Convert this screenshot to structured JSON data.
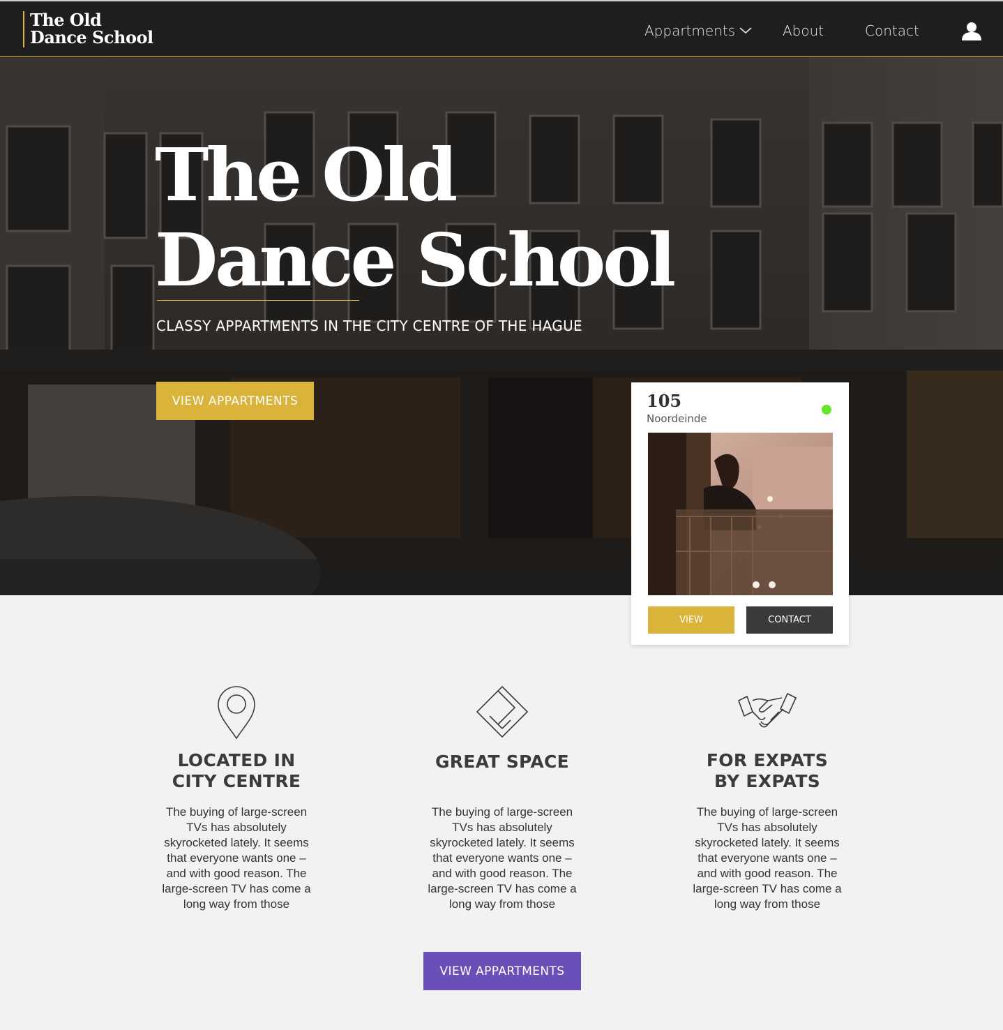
{
  "brand": {
    "line1": "The Old",
    "line2": "Dance School"
  },
  "nav": {
    "appartments": "Appartments",
    "about": "About",
    "contact": "Contact"
  },
  "hero": {
    "title_line1": "The Old",
    "title_line2": "Dance School",
    "subtitle": "CLASSY APPARTMENTS IN THE CITY CENTRE OF THE HAGUE",
    "cta": "VIEW APPARTMENTS"
  },
  "listing": {
    "number": "105",
    "street": "Noordeinde",
    "status_color": "#66e62a",
    "view_label": "VIEW",
    "contact_label": "CONTACT"
  },
  "features": [
    {
      "icon": "location-pin-icon",
      "title_line1": "LOCATED IN",
      "title_line2": "CITY CENTRE",
      "text": "The buying of large-screen TVs has absolutely skyrocketed lately. It seems that everyone wants one – and with good reason. The large-screen TV has come a long way from those"
    },
    {
      "icon": "floorplan-icon",
      "title_line1": "GREAT SPACE",
      "title_line2": "",
      "text": "The buying of large-screen TVs has absolutely skyrocketed lately. It seems that everyone wants one – and with good reason. The large-screen TV has come a long way from those"
    },
    {
      "icon": "handshake-icon",
      "title_line1": "FOR EXPATS",
      "title_line2": "BY EXPATS",
      "text": "The buying of large-screen TVs has absolutely skyrocketed lately. It seems that everyone wants one – and with good reason. The large-screen TV has come a long way from those"
    }
  ],
  "cta_bottom": "VIEW APPARTMENTS",
  "colors": {
    "accent_gold": "#dab33a",
    "accent_purple": "#6b4fb8",
    "nav_bg": "#1e1e1e"
  }
}
